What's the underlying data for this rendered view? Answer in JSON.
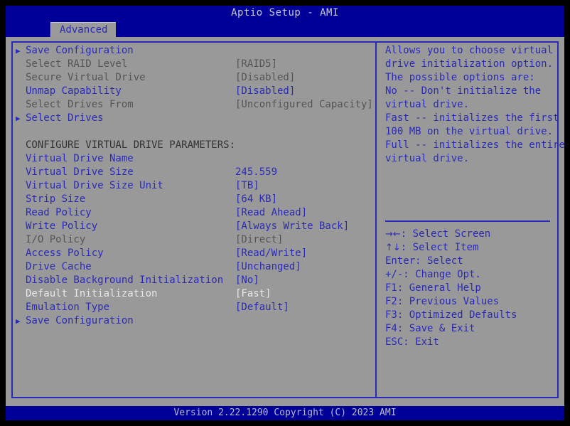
{
  "window": {
    "title": "Aptio Setup - AMI",
    "footer": "Version 2.22.1290 Copyright (C) 2023 AMI"
  },
  "tabs": [
    {
      "label": "Advanced",
      "active": true
    }
  ],
  "colors": {
    "background": "#999999",
    "header_blue": "#000099",
    "text_active": "#2a2ab8",
    "text_disabled": "#555555",
    "text_selected": "#e8e8e8",
    "outer_black": "#000000"
  },
  "menu": {
    "rows": [
      {
        "arrow": "▶",
        "label": "Save Configuration",
        "value": "",
        "state": "active"
      },
      {
        "arrow": "",
        "label": "Select RAID Level",
        "value": "[RAID5]",
        "state": "disabled"
      },
      {
        "arrow": "",
        "label": "Secure Virtual Drive",
        "value": "[Disabled]",
        "state": "disabled"
      },
      {
        "arrow": "",
        "label": "Unmap Capability",
        "value": "[Disabled]",
        "state": "active"
      },
      {
        "arrow": "",
        "label": "Select Drives From",
        "value": "[Unconfigured Capacity]",
        "state": "disabled"
      },
      {
        "arrow": "▶",
        "label": "Select Drives",
        "value": "",
        "state": "active"
      },
      {
        "arrow": "",
        "label": "",
        "value": "",
        "state": "spacer"
      },
      {
        "arrow": "",
        "label": "CONFIGURE VIRTUAL DRIVE PARAMETERS:",
        "value": "",
        "state": "section"
      },
      {
        "arrow": "",
        "label": "Virtual Drive Name",
        "value": "",
        "state": "active"
      },
      {
        "arrow": "",
        "label": "Virtual Drive Size",
        "value": "245.559",
        "state": "active"
      },
      {
        "arrow": "",
        "label": "Virtual Drive Size Unit",
        "value": "[TB]",
        "state": "active"
      },
      {
        "arrow": "",
        "label": "Strip Size",
        "value": "[64 KB]",
        "state": "active"
      },
      {
        "arrow": "",
        "label": "Read Policy",
        "value": "[Read Ahead]",
        "state": "active"
      },
      {
        "arrow": "",
        "label": "Write Policy",
        "value": "[Always Write Back]",
        "state": "active"
      },
      {
        "arrow": "",
        "label": "I/O Policy",
        "value": "[Direct]",
        "state": "disabled"
      },
      {
        "arrow": "",
        "label": "Access Policy",
        "value": "[Read/Write]",
        "state": "active"
      },
      {
        "arrow": "",
        "label": "Drive Cache",
        "value": "[Unchanged]",
        "state": "active"
      },
      {
        "arrow": "",
        "label": "Disable Background Initialization",
        "value": "[No]",
        "state": "active"
      },
      {
        "arrow": "",
        "label": "Default Initialization",
        "value": "[Fast]",
        "state": "selected"
      },
      {
        "arrow": "",
        "label": "Emulation Type",
        "value": "[Default]",
        "state": "active"
      },
      {
        "arrow": "▶",
        "label": "Save Configuration",
        "value": "",
        "state": "active"
      }
    ]
  },
  "help": {
    "lines": [
      "Allows you to choose virtual",
      "drive initialization option.",
      "The possible options are:",
      "No -- Don't initialize the",
      "virtual drive.",
      "Fast -- initializes the first",
      "100 MB on the virtual drive.",
      "Full -- initializes the entire",
      "virtual drive."
    ],
    "keys": [
      {
        "glyph": "→←",
        "text": ": Select Screen"
      },
      {
        "glyph": "↑↓",
        "text": ": Select Item"
      },
      {
        "glyph": "",
        "text": "Enter: Select"
      },
      {
        "glyph": "",
        "text": "+/-: Change Opt."
      },
      {
        "glyph": "",
        "text": "F1: General Help"
      },
      {
        "glyph": "",
        "text": "F2: Previous Values"
      },
      {
        "glyph": "",
        "text": "F3: Optimized Defaults"
      },
      {
        "glyph": "",
        "text": "F4: Save & Exit"
      },
      {
        "glyph": "",
        "text": "ESC: Exit"
      }
    ]
  }
}
